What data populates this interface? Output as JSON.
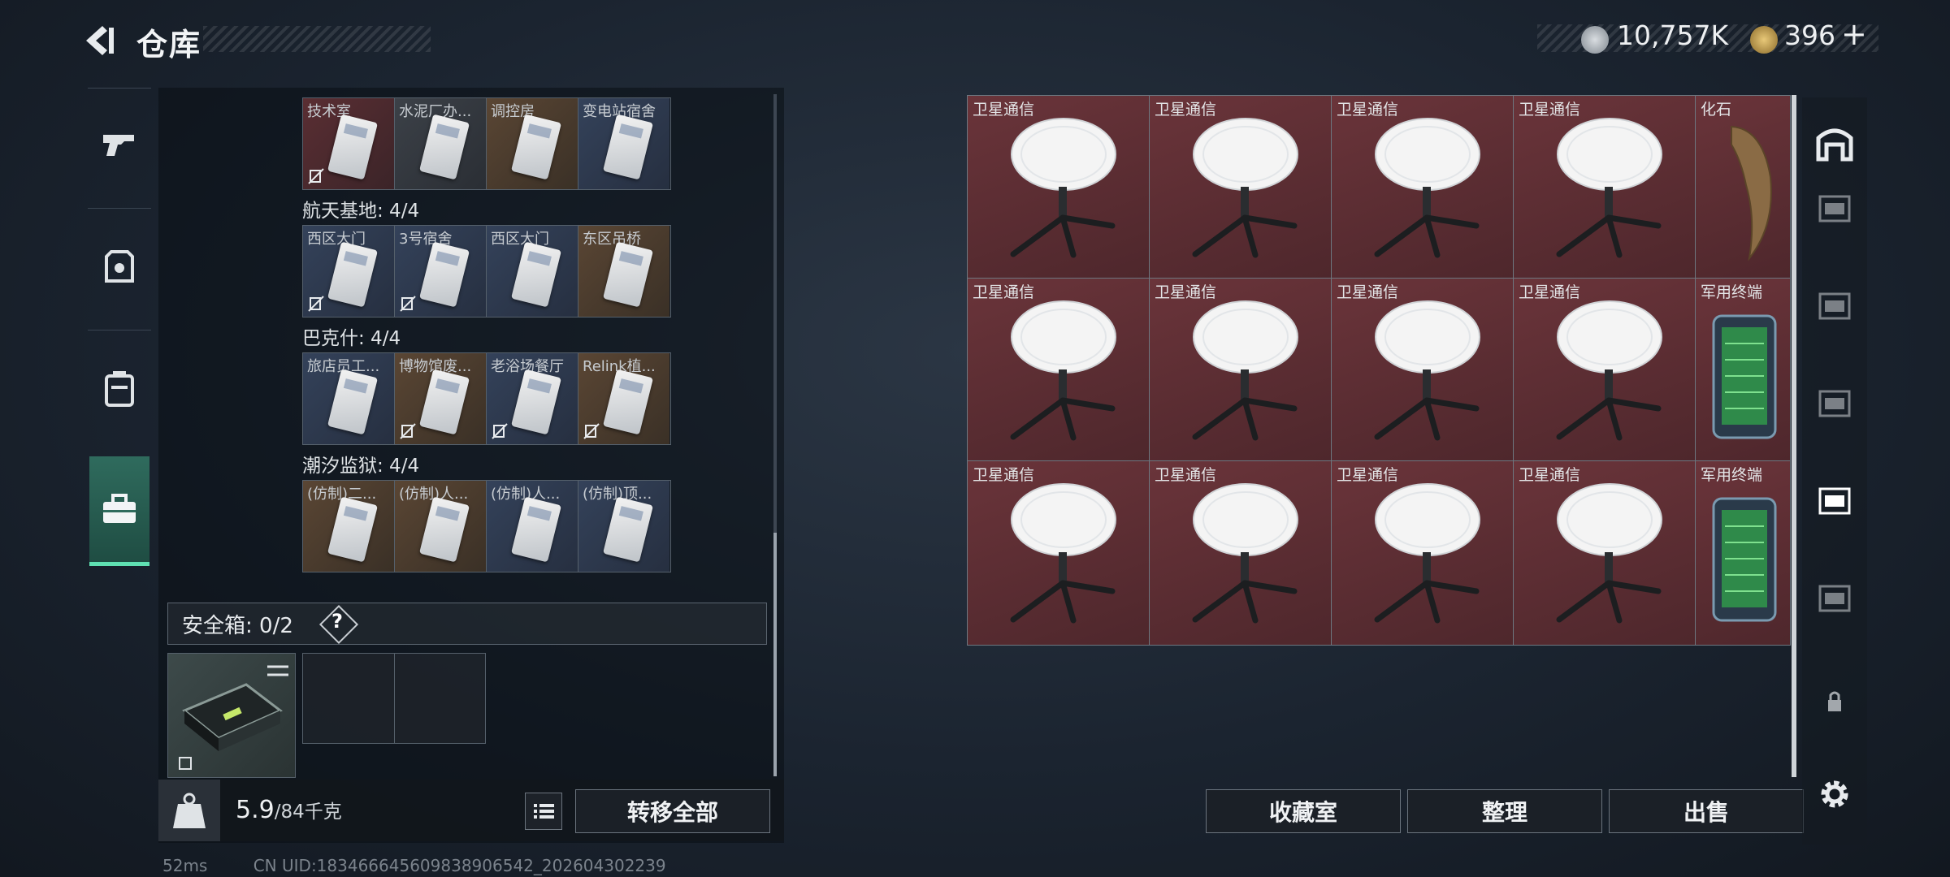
{
  "header": {
    "title": "仓库"
  },
  "currency": {
    "coins": "10,757K",
    "tokens": "396",
    "tokens_plus": "+"
  },
  "left_tabs": [
    "weapon-tab",
    "armor-tab",
    "backpack-tab",
    "case-tab"
  ],
  "key_groups": [
    {
      "label": null,
      "keys": [
        {
          "name": "技术室",
          "bg": "red",
          "nocopy": true
        },
        {
          "name": "水泥厂办...",
          "bg": "gray",
          "nocopy": false
        },
        {
          "name": "调控房",
          "bg": "brown",
          "nocopy": false
        },
        {
          "name": "变电站宿舍",
          "bg": "blue",
          "nocopy": false
        }
      ]
    },
    {
      "label": "航天基地: 4/4",
      "keys": [
        {
          "name": "西区大门",
          "bg": "blue",
          "nocopy": true
        },
        {
          "name": "3号宿舍",
          "bg": "blue",
          "nocopy": true
        },
        {
          "name": "西区大门",
          "bg": "blue",
          "nocopy": false
        },
        {
          "name": "东区吊桥",
          "bg": "brown",
          "nocopy": false
        }
      ]
    },
    {
      "label": "巴克什: 4/4",
      "keys": [
        {
          "name": "旅店员工...",
          "bg": "blue",
          "nocopy": false
        },
        {
          "name": "博物馆废...",
          "bg": "brown",
          "nocopy": true
        },
        {
          "name": "老浴场餐厅",
          "bg": "blue",
          "nocopy": true
        },
        {
          "name": "Relink植...",
          "bg": "brown",
          "nocopy": true
        }
      ]
    },
    {
      "label": "潮汐监狱: 4/4",
      "keys": [
        {
          "name": "(仿制)二...",
          "bg": "brown",
          "nocopy": false
        },
        {
          "name": "(仿制)人...",
          "bg": "brown",
          "nocopy": false
        },
        {
          "name": "(仿制)人...",
          "bg": "blue",
          "nocopy": false
        },
        {
          "name": "(仿制)顶...",
          "bg": "blue",
          "nocopy": false
        }
      ]
    }
  ],
  "safe": {
    "label": "安全箱: 0/2",
    "help": "?"
  },
  "capacity": {
    "current": "5.9",
    "max": "/84千克"
  },
  "buttons": {
    "transfer_all": "转移全部",
    "collection": "收藏室",
    "organize": "整理",
    "sell": "出售"
  },
  "stash_items": [
    {
      "name": "卫星通信",
      "type": "dish"
    },
    {
      "name": "卫星通信",
      "type": "dish"
    },
    {
      "name": "卫星通信",
      "type": "dish"
    },
    {
      "name": "卫星通信",
      "type": "dish"
    },
    {
      "name": "化石",
      "type": "fossil"
    },
    {
      "name": "卫星通信",
      "type": "dish"
    },
    {
      "name": "卫星通信",
      "type": "dish"
    },
    {
      "name": "卫星通信",
      "type": "dish"
    },
    {
      "name": "卫星通信",
      "type": "dish"
    },
    {
      "name": "军用终端",
      "type": "terminal"
    },
    {
      "name": "卫星通信",
      "type": "dish"
    },
    {
      "name": "卫星通信",
      "type": "dish"
    },
    {
      "name": "卫星通信",
      "type": "dish"
    },
    {
      "name": "卫星通信",
      "type": "dish"
    },
    {
      "name": "军用终端",
      "type": "terminal"
    }
  ],
  "status": {
    "ping": "52ms",
    "uid": "CN UID:1834666456098389065​42_202604302239"
  },
  "colors": {
    "accent": "#5fe0b2",
    "stash_bg": "#5d2e33"
  }
}
